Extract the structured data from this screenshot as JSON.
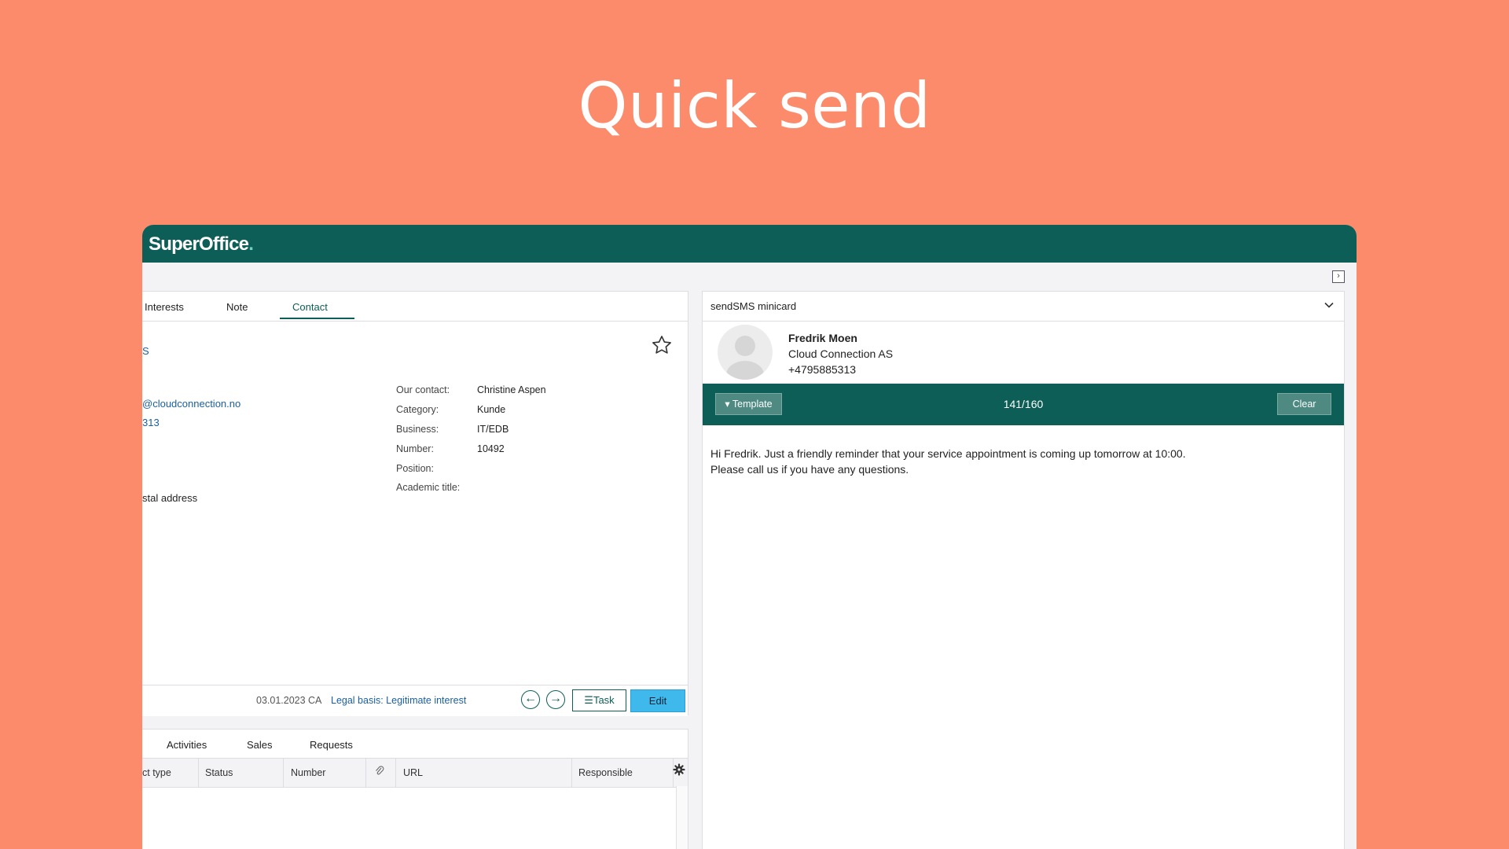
{
  "hero": {
    "title": "Quick send"
  },
  "app": {
    "logo": "SuperOffice",
    "logo_dot": ".",
    "brand_color": "#0d5e56",
    "accent_color": "#3fb8ec"
  },
  "left_panel": {
    "tabs": [
      {
        "label": "Interests"
      },
      {
        "label": "Note"
      },
      {
        "label": "Contact",
        "active": true
      }
    ],
    "fragments": {
      "company_tail": "S",
      "email_tail": "@cloudconnection.no",
      "phone_tail": "313",
      "postal": "stal address"
    },
    "info": [
      {
        "label": "Our contact:",
        "value": "Christine Aspen"
      },
      {
        "label": "Category:",
        "value": "Kunde"
      },
      {
        "label": "Business:",
        "value": "IT/EDB"
      },
      {
        "label": "Number:",
        "value": "10492"
      },
      {
        "label": "Position:",
        "value": ""
      },
      {
        "label": "Academic title:",
        "value": ""
      }
    ],
    "footer": {
      "date": "03.01.2023 CA",
      "legal": "Legal basis: Legitimate interest",
      "task_label": "Task",
      "edit_label": "Edit"
    }
  },
  "bottom_panel": {
    "tabs": [
      {
        "label": "Activities"
      },
      {
        "label": "Sales"
      },
      {
        "label": "Requests"
      }
    ],
    "columns": [
      "ct type",
      "Status",
      "Number",
      "URL",
      "Responsible"
    ]
  },
  "right_panel": {
    "title": "sendSMS minicard",
    "contact": {
      "name": "Fredrik Moen",
      "company": "Cloud Connection AS",
      "phone": "+4795885313"
    },
    "toolbar": {
      "template_label": "Template",
      "counter": "141/160",
      "clear_label": "Clear"
    },
    "message": "Hi Fredrik. Just a friendly reminder that your service appointment is coming up tomorrow at 10:00.\nPlease call us if you have any questions."
  }
}
